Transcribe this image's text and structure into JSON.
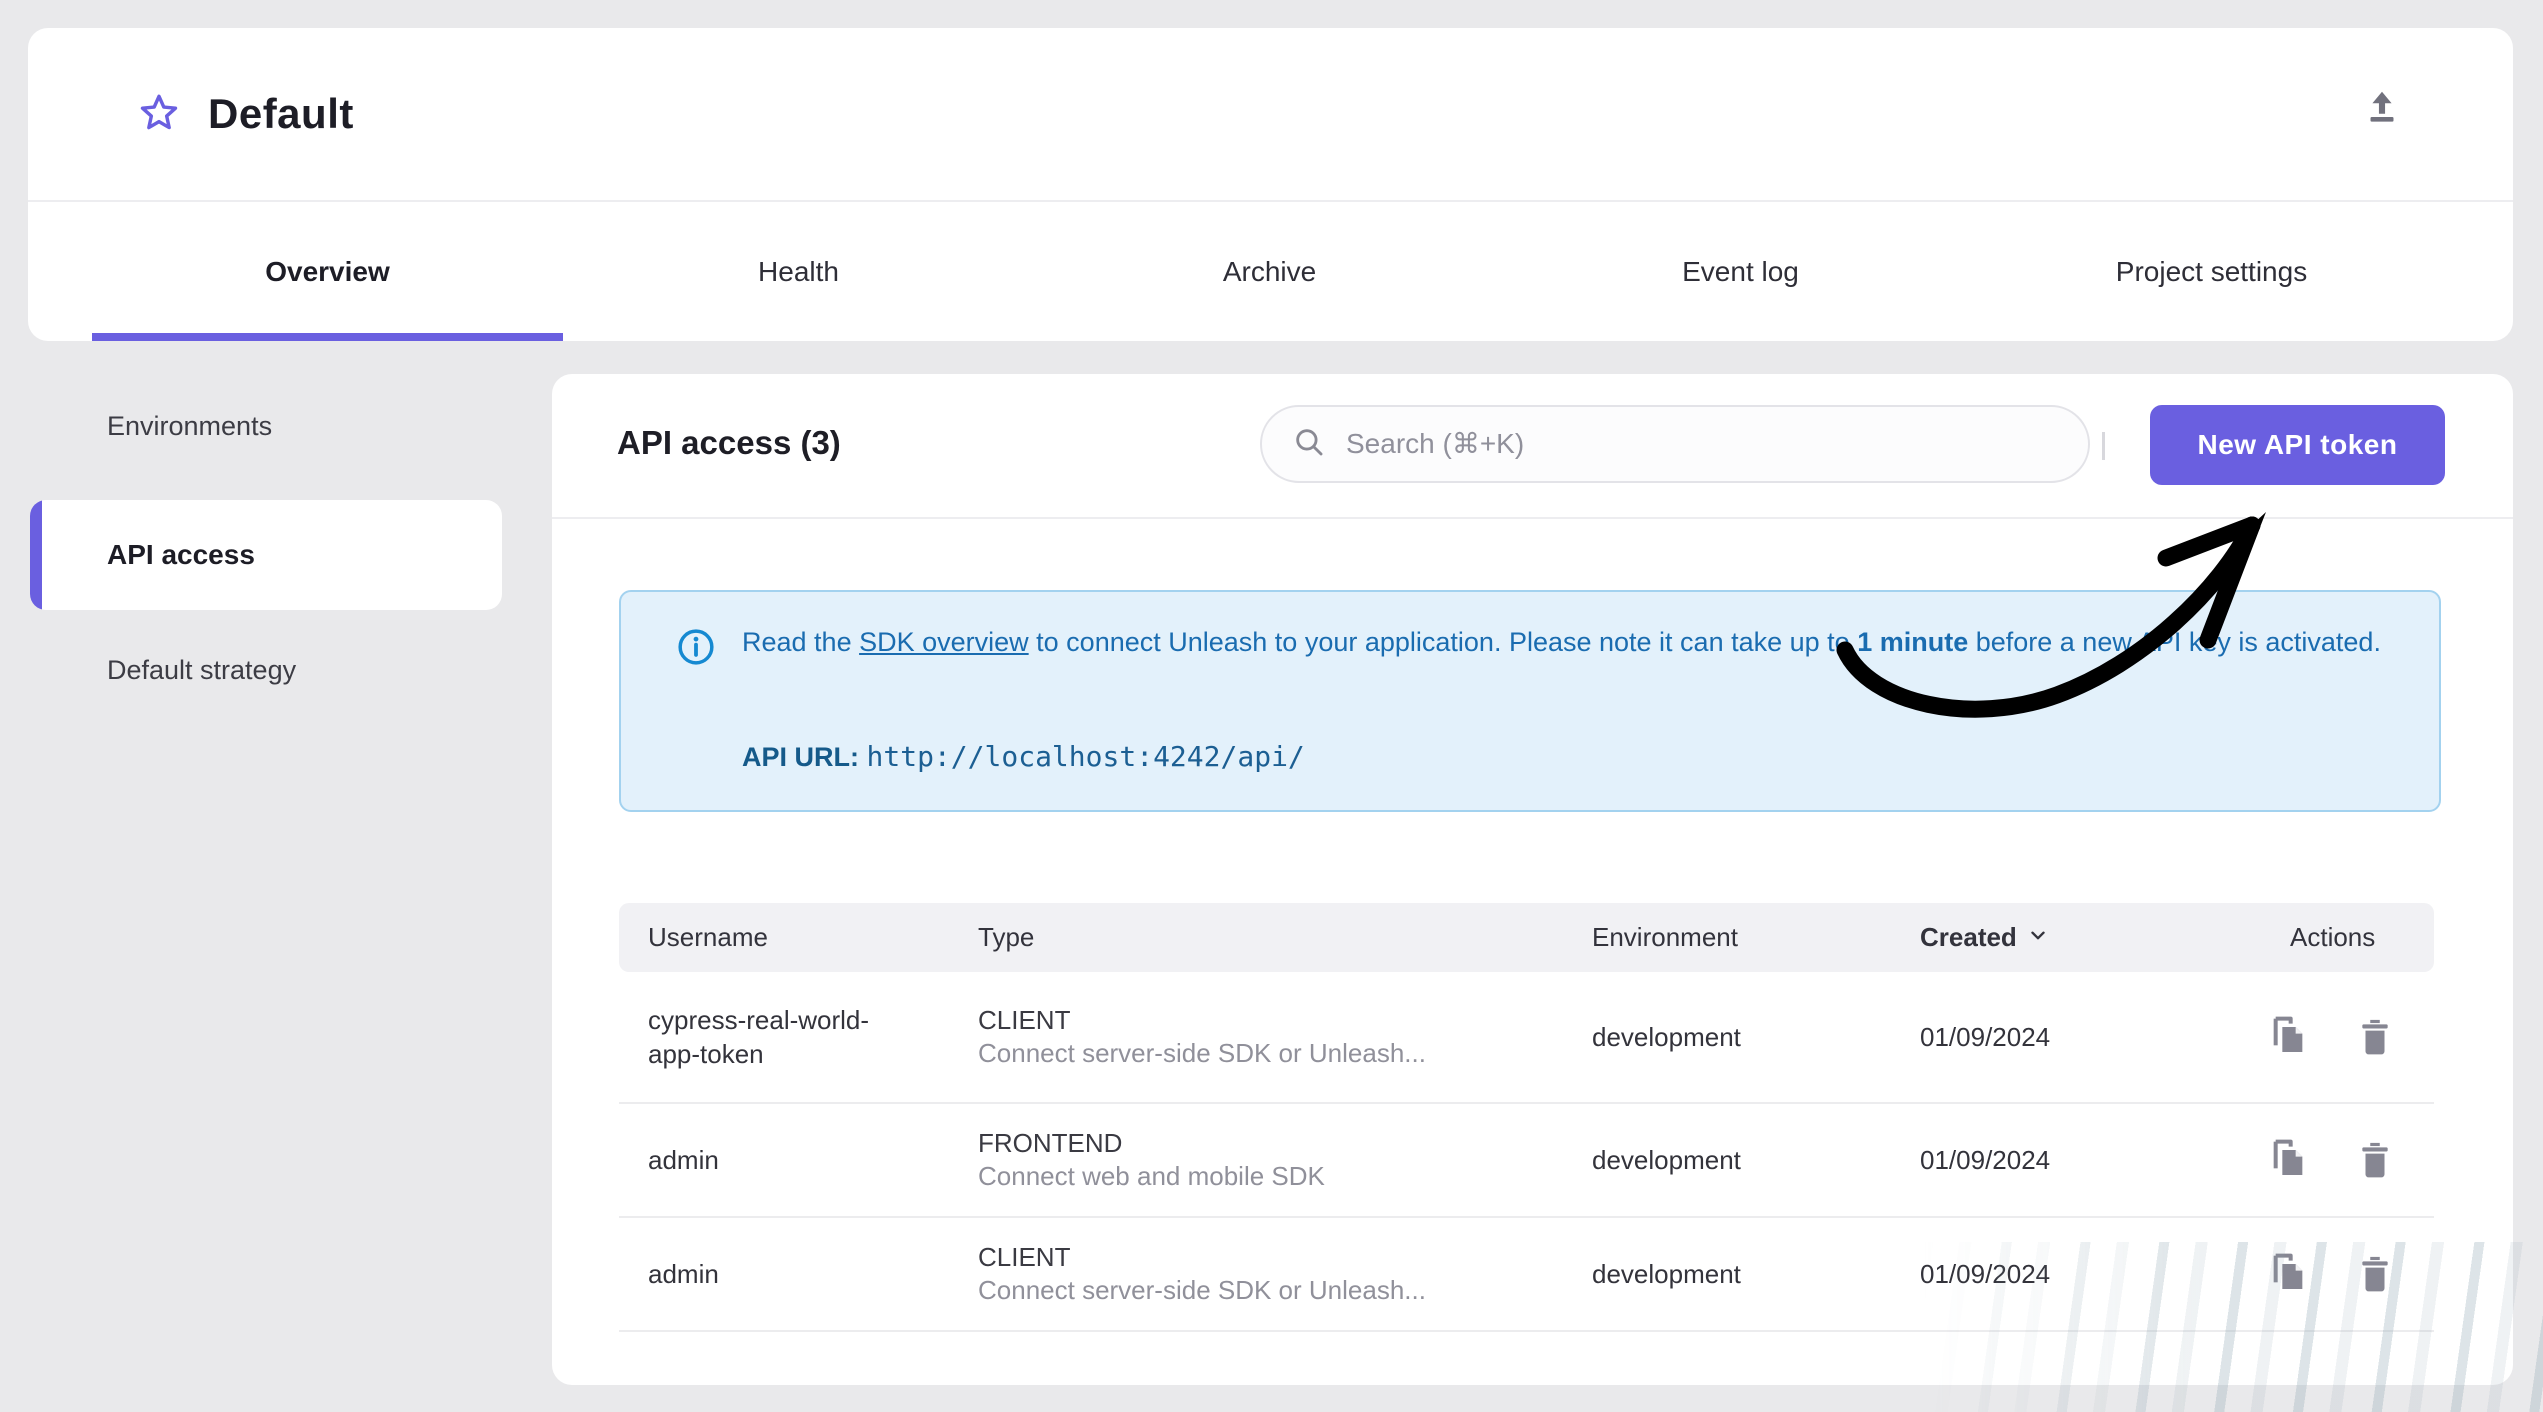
{
  "header": {
    "title": "Default",
    "star_icon": "star-outline",
    "upload_icon": "upload-arrow"
  },
  "tabs": [
    {
      "label": "Overview",
      "active": true
    },
    {
      "label": "Health",
      "active": false
    },
    {
      "label": "Archive",
      "active": false
    },
    {
      "label": "Event log",
      "active": false
    },
    {
      "label": "Project settings",
      "active": false
    }
  ],
  "sidebar": {
    "items": [
      {
        "label": "Environments",
        "active": false
      },
      {
        "label": "API access",
        "active": true
      },
      {
        "label": "Default strategy",
        "active": false
      }
    ]
  },
  "main": {
    "heading": "API access (3)",
    "search": {
      "placeholder": "Search (⌘+K)",
      "icon": "search-magnifier"
    },
    "new_token_button": "New API token",
    "alert": {
      "icon": "info-circle",
      "text_before_link": "Read the ",
      "link": "SDK overview",
      "text_middle": " to connect Unleash to your application. Please note it can take up to ",
      "bold": "1 minute",
      "text_after": " before a new API key is activated.",
      "api_url_label": "API URL",
      "api_url_separator": ": ",
      "api_url_value": "http://localhost:4242/api/"
    },
    "table": {
      "columns": [
        "Username",
        "Type",
        "Environment",
        "Created",
        "Actions"
      ],
      "sorted_column": "Created",
      "sort_direction": "desc",
      "rows": [
        {
          "username": "cypress-real-world-app-token",
          "type": "CLIENT",
          "type_desc": "Connect server-side SDK or Unleash...",
          "environment": "development",
          "created": "01/09/2024"
        },
        {
          "username": "admin",
          "type": "FRONTEND",
          "type_desc": "Connect web and mobile SDK",
          "environment": "development",
          "created": "01/09/2024"
        },
        {
          "username": "admin",
          "type": "CLIENT",
          "type_desc": "Connect server-side SDK or Unleash...",
          "environment": "development",
          "created": "01/09/2024"
        }
      ]
    }
  },
  "colors": {
    "accent_purple": "#6a5fe0",
    "page_background": "#e9e9eb",
    "alert_background": "#e3f1fb",
    "alert_border": "#a3d2ef",
    "alert_text": "#1a6cb0",
    "info_icon_blue": "#1589d1",
    "action_icon_gray": "#868692",
    "arrow_black": "#000000"
  }
}
